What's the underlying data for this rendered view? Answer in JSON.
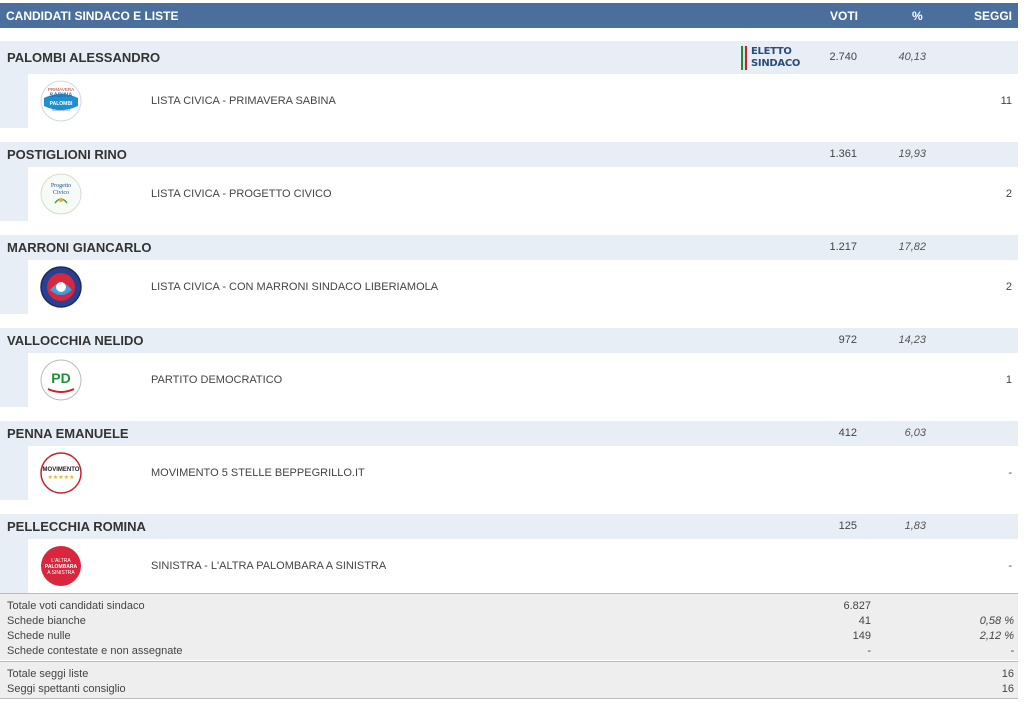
{
  "header": {
    "title": "CANDIDATI SINDACO E LISTE",
    "voti": "VOTI",
    "pct": "%",
    "seggi": "SEGGI"
  },
  "elected_badge": {
    "line1": "ELETTO",
    "line2": "SINDACO",
    "icon": "italian-flag-icon"
  },
  "candidates": [
    {
      "name": "PALOMBI ALESSANDRO",
      "votes": "2.740",
      "pct": "40,13",
      "elected": true,
      "list": {
        "name": "LISTA CIVICA - PRIMAVERA SABINA",
        "seats": "11",
        "logo_lines": [
          "PRIMAVERA",
          "SABINA",
          "PALOMBI",
          "SINDACO"
        ]
      }
    },
    {
      "name": "POSTIGLIONI RINO",
      "votes": "1.361",
      "pct": "19,93",
      "elected": false,
      "list": {
        "name": "LISTA CIVICA - PROGETTO CIVICO",
        "seats": "2",
        "logo_lines": [
          "Progetto",
          "Civico"
        ]
      }
    },
    {
      "name": "MARRONI GIANCARLO",
      "votes": "1.217",
      "pct": "17,82",
      "elected": false,
      "list": {
        "name": "LISTA CIVICA - CON MARRONI SINDACO LIBERIAMOLA",
        "seats": "2",
        "logo_lines": []
      }
    },
    {
      "name": "VALLOCCHIA NELIDO",
      "votes": "972",
      "pct": "14,23",
      "elected": false,
      "list": {
        "name": "PARTITO DEMOCRATICO",
        "seats": "1",
        "logo_lines": [
          "PD"
        ]
      }
    },
    {
      "name": "PENNA EMANUELE",
      "votes": "412",
      "pct": "6,03",
      "elected": false,
      "list": {
        "name": "MOVIMENTO 5 STELLE BEPPEGRILLO.IT",
        "seats": "-",
        "logo_lines": [
          "MOVIMENTO",
          "★★★★★"
        ]
      }
    },
    {
      "name": "PELLECCHIA ROMINA",
      "votes": "125",
      "pct": "1,83",
      "elected": false,
      "list": {
        "name": "SINISTRA - L'ALTRA PALOMBARA A SINISTRA",
        "seats": "-",
        "logo_lines": [
          "L'ALTRA",
          "PALOMBARA",
          "A SINISTRA"
        ]
      }
    }
  ],
  "totals": [
    {
      "label": "Totale voti candidati sindaco",
      "value": "6.827",
      "pct": ""
    },
    {
      "label": "Schede bianche",
      "value": "41",
      "pct": "0,58 %"
    },
    {
      "label": "Schede nulle",
      "value": "149",
      "pct": "2,12 %"
    },
    {
      "label": "Schede contestate e non assegnate",
      "value": "-",
      "pct": "-"
    }
  ],
  "seats": [
    {
      "label": "Totale seggi liste",
      "value": "16"
    },
    {
      "label": "Seggi spettanti consiglio",
      "value": "16"
    }
  ],
  "colors": {
    "header_bg": "#4a6f9c",
    "candidate_row_bg": "#e8eef5",
    "totals_bg": "#eeeeee"
  }
}
